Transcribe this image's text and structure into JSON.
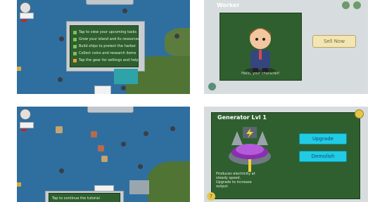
{
  "panel1": {
    "overlay_items": [
      "Tap to view your upcoming tasks",
      "Grow your island and its resources",
      "Build ships to protect the harbor",
      "Collect coins and research items",
      "Tap the gear for settings and help"
    ]
  },
  "panel2": {
    "title": "Worker",
    "caption": "Hello, your character!",
    "button_label": "Sell Now"
  },
  "panel3": {
    "banner_text": "Tap to continue the tutorial"
  },
  "panel4": {
    "title": "Generator Lvl 1",
    "upgrade_label": "Upgrade",
    "demolish_label": "Demolish",
    "description": [
      "Produces electricity at",
      "steady speed.",
      "Upgrade to increase",
      "output."
    ],
    "question_icon": "?"
  }
}
